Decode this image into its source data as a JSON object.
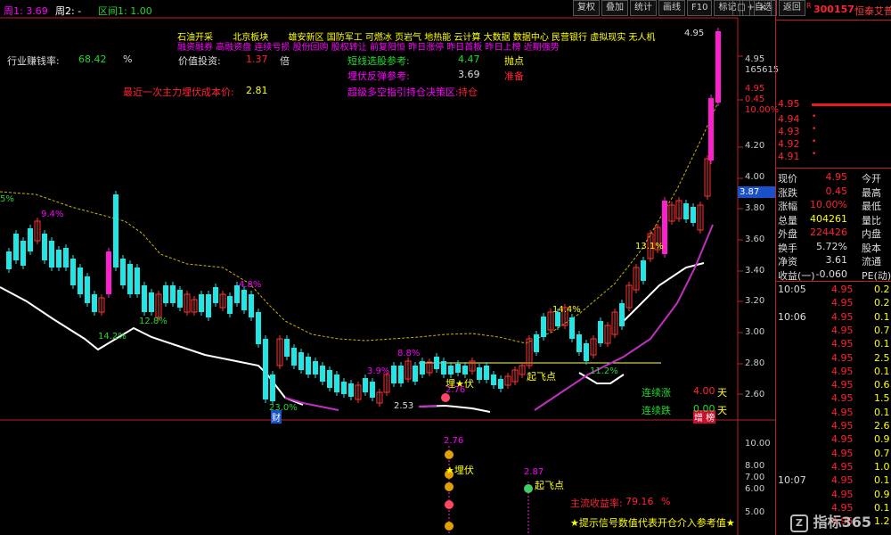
{
  "header": {
    "ma_labels": [
      "周1: 3.69",
      "周2: -"
    ],
    "range_label": "区间1: 1.00"
  },
  "toolbar": {
    "buttons": [
      "复权",
      "叠加",
      "统计",
      "画线",
      "F10",
      "标记",
      "+自选",
      "返回"
    ],
    "window_buttons": [
      "□",
      "×"
    ]
  },
  "concepts": {
    "row1": [
      "石油开采",
      "北京板块",
      "雄安新区",
      "国防军工",
      "可燃冰",
      "页岩气",
      "地热能",
      "云计算",
      "大数据",
      "数据中心",
      "民营银行",
      "虚拟现实",
      "无人机"
    ],
    "row2": [
      "融资融券",
      "高融资盘",
      "连续亏损",
      "股份回购",
      "股权转让",
      "前复阳恒",
      "昨日涨停",
      "昨日首板",
      "昨日上榜",
      "近期强势"
    ]
  },
  "indicators": {
    "industry_return_label": "行业赚钱率:",
    "industry_return_value": "68.42",
    "industry_return_unit": "%",
    "value_invest_label": "价值投资:",
    "value_invest_value": "1.37",
    "value_invest_unit": "倍",
    "last_cost_label": "最近一次主力埋伏成本价:",
    "last_cost_value": "2.81",
    "short_ref_label": "短线选股参考:",
    "short_ref_value": "4.47",
    "short_ref_signal": "抛点",
    "ambush_ref_label": "埋伏反弹参考:",
    "ambush_ref_value": "3.69",
    "ambush_ref_signal": "准备",
    "ultra_label": "超级多空指引持仓决策区:",
    "ultra_value": "持仓"
  },
  "price_axis": [
    "4.95",
    "165615",
    "4.95",
    "0.45",
    "10.00%",
    "4.20",
    "4.00",
    "3.80",
    "3.60",
    "3.40",
    "3.20",
    "3.00",
    "2.80",
    "2.60"
  ],
  "current_price_tag": "3.87",
  "lower_axis": [
    "10.00",
    "8.00",
    "7.00",
    "6.00",
    "5.00"
  ],
  "annotations": {
    "high": "4.95",
    "low": "2.53",
    "pct_labels": [
      "9.4%",
      "4.8%",
      "14.2%",
      "12.8%",
      "23.0%",
      "3.9%",
      "8.8%",
      "14.4%",
      "11.2%",
      "13.1%",
      "5%"
    ],
    "ambush_star": "埋★伏",
    "ambush_price": "2.76",
    "takeoff": "起飞点",
    "bottom_left_tag": "财",
    "bottom_right_tag": "增  榜",
    "streak_up_label": "连续涨",
    "streak_up_value": "4.00",
    "streak_up_unit": "天",
    "streak_down_label": "连续跌",
    "streak_down_value": "0.00",
    "streak_down_unit": "天"
  },
  "lower_panel": {
    "ambush_price": "2.76",
    "ambush_text": "★埋伏",
    "takeoff_price": "2.87",
    "takeoff_text": "起飞点",
    "main_return_label": "主流收益率:",
    "main_return_value": "79.16",
    "main_return_unit": "%",
    "hint": "★提示信号数值代表开仓介入参考值★"
  },
  "stock": {
    "flag": "R",
    "code": "300157",
    "name": "恒泰艾普",
    "bid_price": "4.95",
    "asks": [
      {
        "price": "4.94"
      },
      {
        "price": "4.93"
      },
      {
        "price": "4.92"
      },
      {
        "price": "4.91"
      }
    ]
  },
  "quote": [
    {
      "l1": "现价",
      "v1": "4.95",
      "l2": "今开"
    },
    {
      "l1": "涨跌",
      "v1": "0.45",
      "l2": "最高"
    },
    {
      "l1": "涨幅",
      "v1": "10.00%",
      "l2": "最低"
    },
    {
      "l1": "总量",
      "v1": "404261",
      "l2": "量比"
    },
    {
      "l1": "外盘",
      "v1": "224426",
      "l2": "内盘"
    },
    {
      "l1": "换手",
      "v1": "5.72%",
      "l2": "股本"
    },
    {
      "l1": "净资",
      "v1": "3.61",
      "l2": "流通"
    },
    {
      "l1": "收益(一)",
      "v1": "-0.060",
      "l2": "PE(动)"
    }
  ],
  "ticks": [
    {
      "time": "10:05",
      "price": "4.95",
      "vol": "0.2"
    },
    {
      "time": "",
      "price": "4.95",
      "vol": "0.2"
    },
    {
      "time": "10:06",
      "price": "4.95",
      "vol": "0.1"
    },
    {
      "time": "",
      "price": "4.95",
      "vol": "0.7"
    },
    {
      "time": "",
      "price": "4.95",
      "vol": "0.1"
    },
    {
      "time": "",
      "price": "4.95",
      "vol": "2.5"
    },
    {
      "time": "",
      "price": "4.95",
      "vol": "0.1"
    },
    {
      "time": "",
      "price": "4.95",
      "vol": "0.6"
    },
    {
      "time": "",
      "price": "4.95",
      "vol": "1.5"
    },
    {
      "time": "",
      "price": "4.95",
      "vol": "0.1"
    },
    {
      "time": "",
      "price": "4.95",
      "vol": "2.6"
    },
    {
      "time": "",
      "price": "4.95",
      "vol": "0.9"
    },
    {
      "time": "",
      "price": "4.95",
      "vol": "0.7"
    },
    {
      "time": "",
      "price": "4.95",
      "vol": "1.0"
    },
    {
      "time": "10:07",
      "price": "4.95",
      "vol": "0.1"
    },
    {
      "time": "",
      "price": "4.95",
      "vol": "0.9"
    },
    {
      "time": "",
      "price": "4.95",
      "vol": "0.1"
    },
    {
      "time": "",
      "price": "4.95",
      "vol": "1.2"
    }
  ],
  "watermark": "指标365"
}
